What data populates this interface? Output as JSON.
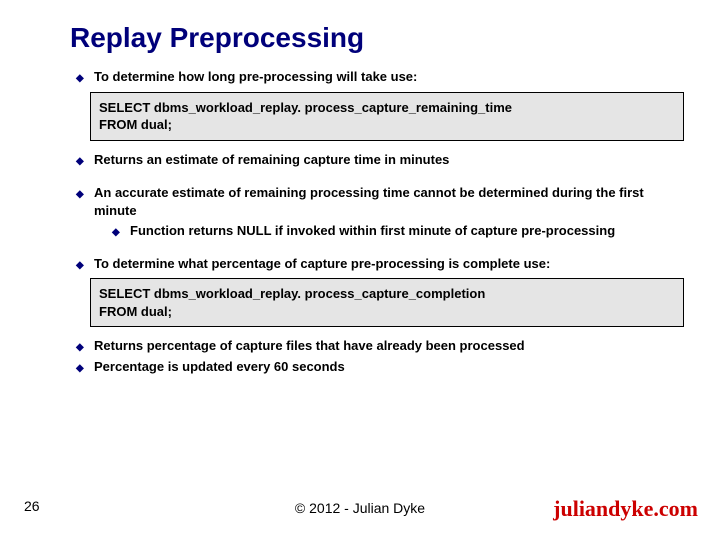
{
  "title": "Replay Preprocessing",
  "bullets": {
    "p1": "To determine how long pre-processing will take use:",
    "code1": "SELECT dbms_workload_replay. process_capture_remaining_time\nFROM dual;",
    "p2": "Returns an estimate of remaining capture time in minutes",
    "p3": "An accurate estimate of remaining processing time cannot be determined during the first minute",
    "p3a": "Function returns NULL if invoked within first minute of capture pre-processing",
    "p4": "To determine what percentage of capture pre-processing is complete use:",
    "code2": "SELECT dbms_workload_replay. process_capture_completion\nFROM dual;",
    "p5": "Returns percentage of capture files that have already been processed",
    "p6": "Percentage is updated every 60 seconds"
  },
  "footer": {
    "page": "26",
    "copyright": "© 2012 - Julian Dyke",
    "brand": "juliandyke.com"
  }
}
